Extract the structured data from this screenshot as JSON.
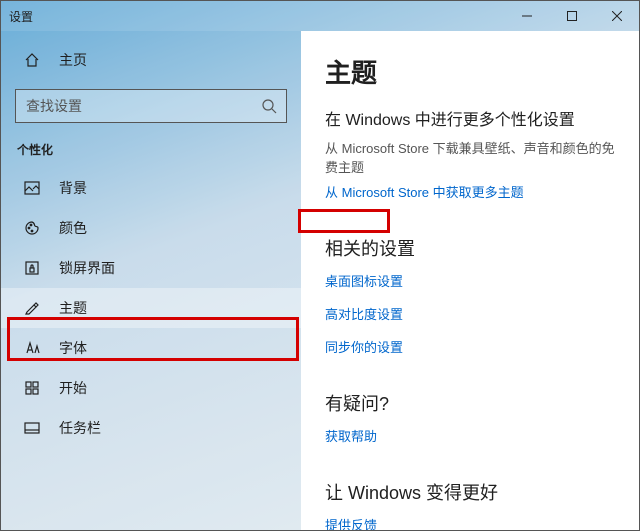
{
  "window": {
    "title": "设置"
  },
  "titlebar": {
    "min": "minimize",
    "max": "maximize",
    "close": "close"
  },
  "home_label": "主页",
  "search": {
    "placeholder": "查找设置"
  },
  "category_label": "个性化",
  "nav": [
    {
      "label": "背景"
    },
    {
      "label": "颜色"
    },
    {
      "label": "锁屏界面"
    },
    {
      "label": "主题"
    },
    {
      "label": "字体"
    },
    {
      "label": "开始"
    },
    {
      "label": "任务栏"
    }
  ],
  "content": {
    "title": "主题",
    "more_heading": "在 Windows 中进行更多个性化设置",
    "more_desc": "从 Microsoft Store 下载兼具壁纸、声音和颜色的免费主题",
    "more_link": "从 Microsoft Store 中获取更多主题",
    "related_heading": "相关的设置",
    "related_links": [
      "桌面图标设置",
      "高对比度设置",
      "同步你的设置"
    ],
    "help_heading": "有疑问?",
    "help_link": "获取帮助",
    "better_heading": "让 Windows 变得更好",
    "feedback_link": "提供反馈"
  }
}
